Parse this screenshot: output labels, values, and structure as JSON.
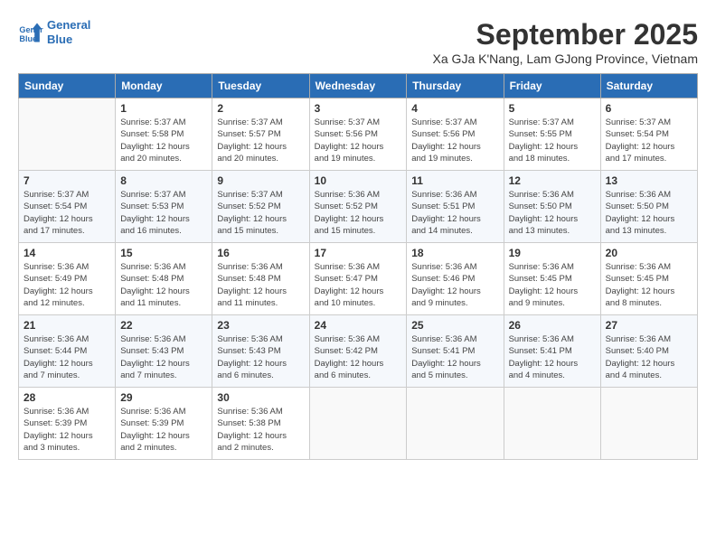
{
  "header": {
    "logo_line1": "General",
    "logo_line2": "Blue",
    "title": "September 2025",
    "subtitle": "Xa GJa K'Nang, Lam GJong Province, Vietnam"
  },
  "columns": [
    "Sunday",
    "Monday",
    "Tuesday",
    "Wednesday",
    "Thursday",
    "Friday",
    "Saturday"
  ],
  "weeks": [
    [
      {
        "day": "",
        "info": ""
      },
      {
        "day": "1",
        "info": "Sunrise: 5:37 AM\nSunset: 5:58 PM\nDaylight: 12 hours\nand 20 minutes."
      },
      {
        "day": "2",
        "info": "Sunrise: 5:37 AM\nSunset: 5:57 PM\nDaylight: 12 hours\nand 20 minutes."
      },
      {
        "day": "3",
        "info": "Sunrise: 5:37 AM\nSunset: 5:56 PM\nDaylight: 12 hours\nand 19 minutes."
      },
      {
        "day": "4",
        "info": "Sunrise: 5:37 AM\nSunset: 5:56 PM\nDaylight: 12 hours\nand 19 minutes."
      },
      {
        "day": "5",
        "info": "Sunrise: 5:37 AM\nSunset: 5:55 PM\nDaylight: 12 hours\nand 18 minutes."
      },
      {
        "day": "6",
        "info": "Sunrise: 5:37 AM\nSunset: 5:54 PM\nDaylight: 12 hours\nand 17 minutes."
      }
    ],
    [
      {
        "day": "7",
        "info": "Sunrise: 5:37 AM\nSunset: 5:54 PM\nDaylight: 12 hours\nand 17 minutes."
      },
      {
        "day": "8",
        "info": "Sunrise: 5:37 AM\nSunset: 5:53 PM\nDaylight: 12 hours\nand 16 minutes."
      },
      {
        "day": "9",
        "info": "Sunrise: 5:37 AM\nSunset: 5:52 PM\nDaylight: 12 hours\nand 15 minutes."
      },
      {
        "day": "10",
        "info": "Sunrise: 5:36 AM\nSunset: 5:52 PM\nDaylight: 12 hours\nand 15 minutes."
      },
      {
        "day": "11",
        "info": "Sunrise: 5:36 AM\nSunset: 5:51 PM\nDaylight: 12 hours\nand 14 minutes."
      },
      {
        "day": "12",
        "info": "Sunrise: 5:36 AM\nSunset: 5:50 PM\nDaylight: 12 hours\nand 13 minutes."
      },
      {
        "day": "13",
        "info": "Sunrise: 5:36 AM\nSunset: 5:50 PM\nDaylight: 12 hours\nand 13 minutes."
      }
    ],
    [
      {
        "day": "14",
        "info": "Sunrise: 5:36 AM\nSunset: 5:49 PM\nDaylight: 12 hours\nand 12 minutes."
      },
      {
        "day": "15",
        "info": "Sunrise: 5:36 AM\nSunset: 5:48 PM\nDaylight: 12 hours\nand 11 minutes."
      },
      {
        "day": "16",
        "info": "Sunrise: 5:36 AM\nSunset: 5:48 PM\nDaylight: 12 hours\nand 11 minutes."
      },
      {
        "day": "17",
        "info": "Sunrise: 5:36 AM\nSunset: 5:47 PM\nDaylight: 12 hours\nand 10 minutes."
      },
      {
        "day": "18",
        "info": "Sunrise: 5:36 AM\nSunset: 5:46 PM\nDaylight: 12 hours\nand 9 minutes."
      },
      {
        "day": "19",
        "info": "Sunrise: 5:36 AM\nSunset: 5:45 PM\nDaylight: 12 hours\nand 9 minutes."
      },
      {
        "day": "20",
        "info": "Sunrise: 5:36 AM\nSunset: 5:45 PM\nDaylight: 12 hours\nand 8 minutes."
      }
    ],
    [
      {
        "day": "21",
        "info": "Sunrise: 5:36 AM\nSunset: 5:44 PM\nDaylight: 12 hours\nand 7 minutes."
      },
      {
        "day": "22",
        "info": "Sunrise: 5:36 AM\nSunset: 5:43 PM\nDaylight: 12 hours\nand 7 minutes."
      },
      {
        "day": "23",
        "info": "Sunrise: 5:36 AM\nSunset: 5:43 PM\nDaylight: 12 hours\nand 6 minutes."
      },
      {
        "day": "24",
        "info": "Sunrise: 5:36 AM\nSunset: 5:42 PM\nDaylight: 12 hours\nand 6 minutes."
      },
      {
        "day": "25",
        "info": "Sunrise: 5:36 AM\nSunset: 5:41 PM\nDaylight: 12 hours\nand 5 minutes."
      },
      {
        "day": "26",
        "info": "Sunrise: 5:36 AM\nSunset: 5:41 PM\nDaylight: 12 hours\nand 4 minutes."
      },
      {
        "day": "27",
        "info": "Sunrise: 5:36 AM\nSunset: 5:40 PM\nDaylight: 12 hours\nand 4 minutes."
      }
    ],
    [
      {
        "day": "28",
        "info": "Sunrise: 5:36 AM\nSunset: 5:39 PM\nDaylight: 12 hours\nand 3 minutes."
      },
      {
        "day": "29",
        "info": "Sunrise: 5:36 AM\nSunset: 5:39 PM\nDaylight: 12 hours\nand 2 minutes."
      },
      {
        "day": "30",
        "info": "Sunrise: 5:36 AM\nSunset: 5:38 PM\nDaylight: 12 hours\nand 2 minutes."
      },
      {
        "day": "",
        "info": ""
      },
      {
        "day": "",
        "info": ""
      },
      {
        "day": "",
        "info": ""
      },
      {
        "day": "",
        "info": ""
      }
    ]
  ]
}
